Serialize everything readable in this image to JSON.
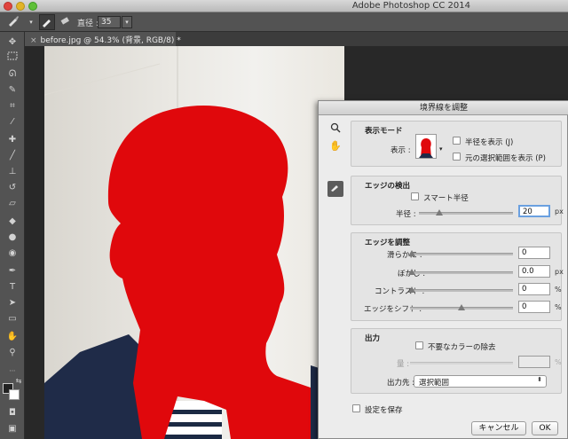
{
  "app": {
    "title": "Adobe Photoshop CC 2014"
  },
  "options_bar": {
    "size_label": "直径 :",
    "size_value": "35"
  },
  "tab": {
    "close": "×",
    "title": "before.jpg @ 54.3% (背景, RGB/8) *"
  },
  "dialog": {
    "title": "境界線を調整",
    "view_mode": {
      "section_title": "表示モード",
      "view_label": "表示 :",
      "show_radius_label": "半径を表示 (J)",
      "show_original_label": "元の選択範囲を表示 (P)"
    },
    "edge_detection": {
      "section_title": "エッジの検出",
      "smart_radius_label": "スマート半径",
      "radius_label": "半径 :",
      "radius_value": "20",
      "radius_unit": "px",
      "radius_fraction": 0.22
    },
    "adjust_edge": {
      "section_title": "エッジを調整",
      "smooth_label": "滑らかに :",
      "smooth_value": "0",
      "feather_label": "ぼかし :",
      "feather_value": "0.0",
      "feather_unit": "px",
      "contrast_label": "コントラスト :",
      "contrast_value": "0",
      "contrast_unit": "%",
      "shift_label": "エッジをシフト :",
      "shift_value": "0",
      "shift_unit": "%"
    },
    "output": {
      "section_title": "出力",
      "decontaminate_label": "不要なカラーの除去",
      "amount_label": "量 :",
      "amount_unit": "%",
      "output_to_label": "出力先 :",
      "output_to_value": "選択範囲"
    },
    "remember_label": "設定を保存",
    "cancel_label": "キャンセル",
    "ok_label": "OK"
  },
  "colors": {
    "overlay_red": "#e0080c",
    "toolbar_gray": "#535353",
    "dialog_bg": "#ececec"
  }
}
